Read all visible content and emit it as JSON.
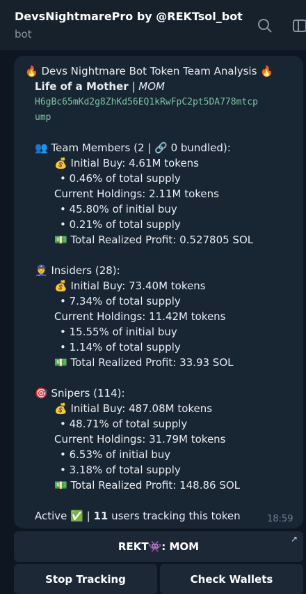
{
  "header": {
    "title": "DevsNightmarePro by @REKTsol_bot",
    "subtitle": "bot",
    "search_icon": "search-icon",
    "sidebar_icon": "sidebar-toggle-icon"
  },
  "message": {
    "heading": "🔥 Devs Nightmare Bot Token Team Analysis 🔥",
    "token_name": "Life of a Mother",
    "separator": "|",
    "ticker": "MOM",
    "address_line1": "H6gBc65mKd2g8ZhKd56EQ1kRwFpC2pt5DA778mtcp",
    "address_line2": "ump",
    "team": {
      "header": "👥 Team Members (2 | 🔗 0 bundled):",
      "initial_buy": "💰 Initial Buy: 4.61M tokens",
      "initial_supply": "• 0.46% of total supply",
      "current_holdings": "Current Holdings: 2.11M tokens",
      "pct_initial": "• 45.80% of initial buy",
      "pct_supply": "• 0.21% of total supply",
      "profit": "💵 Total Realized Profit: 0.527805 SOL"
    },
    "insiders": {
      "header": "👮 Insiders (28):",
      "initial_buy": "💰 Initial Buy: 73.40M tokens",
      "initial_supply": "• 7.34% of total supply",
      "current_holdings": "Current Holdings: 11.42M tokens",
      "pct_initial": "• 15.55% of initial buy",
      "pct_supply": "• 1.14% of total supply",
      "profit": "💵 Total Realized Profit: 33.93 SOL"
    },
    "snipers": {
      "header": "🎯 Snipers (114):",
      "initial_buy": "💰 Initial Buy: 487.08M tokens",
      "initial_supply": "• 48.71% of total supply",
      "current_holdings": "Current Holdings: 31.79M tokens",
      "pct_initial": "• 6.53% of initial buy",
      "pct_supply": "• 3.18% of total supply",
      "profit": "💵 Total Realized Profit: 148.86 SOL"
    },
    "status_prefix": "Active ✅ |",
    "tracking_count": "11",
    "status_suffix": "users tracking this token",
    "time": "18:59"
  },
  "buttons": {
    "rekt_label": "REKT👾: MOM",
    "stop_label": "Stop Tracking",
    "check_label": "Check Wallets"
  }
}
